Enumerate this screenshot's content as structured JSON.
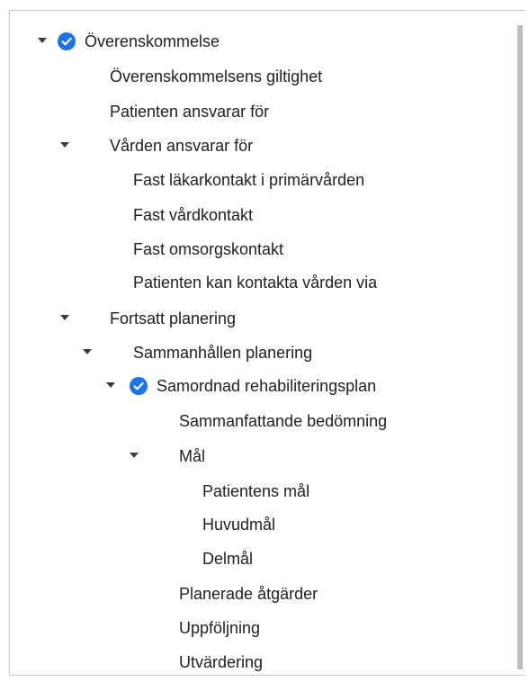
{
  "tree": {
    "nodes": [
      {
        "label": "Överenskommelse",
        "caret": true,
        "check": true
      },
      {
        "label": "Överenskommelsens giltighet",
        "caret": false,
        "check": false
      },
      {
        "label": "Patienten ansvarar för",
        "caret": false,
        "check": false
      },
      {
        "label": "Vården ansvarar för",
        "caret": true,
        "check": false
      },
      {
        "label": "Fast läkarkontakt i primärvården",
        "caret": false,
        "check": false
      },
      {
        "label": "Fast vårdkontakt",
        "caret": false,
        "check": false
      },
      {
        "label": "Fast omsorgskontakt",
        "caret": false,
        "check": false
      },
      {
        "label": "Patienten kan kontakta vården via",
        "caret": false,
        "check": false
      },
      {
        "label": "Fortsatt planering",
        "caret": true,
        "check": false
      },
      {
        "label": "Sammanhållen planering",
        "caret": true,
        "check": false
      },
      {
        "label": "Samordnad rehabiliteringsplan",
        "caret": true,
        "check": true
      },
      {
        "label": "Sammanfattande bedömning",
        "caret": false,
        "check": false
      },
      {
        "label": "Mål",
        "caret": true,
        "check": false
      },
      {
        "label": "Patientens mål",
        "caret": false,
        "check": false
      },
      {
        "label": "Huvudmål",
        "caret": false,
        "check": false
      },
      {
        "label": "Delmål",
        "caret": false,
        "check": false
      },
      {
        "label": "Planerade åtgärder",
        "caret": false,
        "check": false
      },
      {
        "label": "Uppföljning",
        "caret": false,
        "check": false
      },
      {
        "label": "Utvärdering",
        "caret": false,
        "check": false
      }
    ]
  },
  "colors": {
    "check": "#1a73e8",
    "text": "#202124",
    "caret": "#3c3c3c"
  }
}
